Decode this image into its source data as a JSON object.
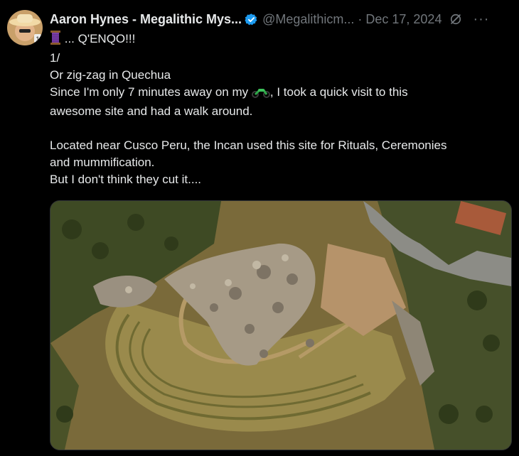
{
  "author": {
    "name": "Aaron Hynes - Megalithic Mys...",
    "handle": "@Megalithicm...",
    "date": "Dec 17, 2024"
  },
  "icons": {
    "avatar": "avatar-photo",
    "verified": "verified-badge-icon",
    "grok": "grok-icon",
    "more": "more-options-icon",
    "thread": "thread-spool-emoji",
    "motorbike": "motorbike-emoji"
  },
  "colors": {
    "verified": "#1d9bf0",
    "background": "#000000"
  },
  "post": {
    "line1": "... Q'ENQO!!!",
    "line2": "1/",
    "line3": "Or zig-zag in Quechua",
    "line4_a": "Since I'm only 7 minutes away on my ",
    "line4_b": ", I took a quick visit to this",
    "line5": "awesome site and had a walk around.",
    "line6": "Located near Cusco Peru, the Incan used this site for Rituals, Ceremonies",
    "line7": "and mummification.",
    "line8": "But I don't think they cut it...."
  }
}
